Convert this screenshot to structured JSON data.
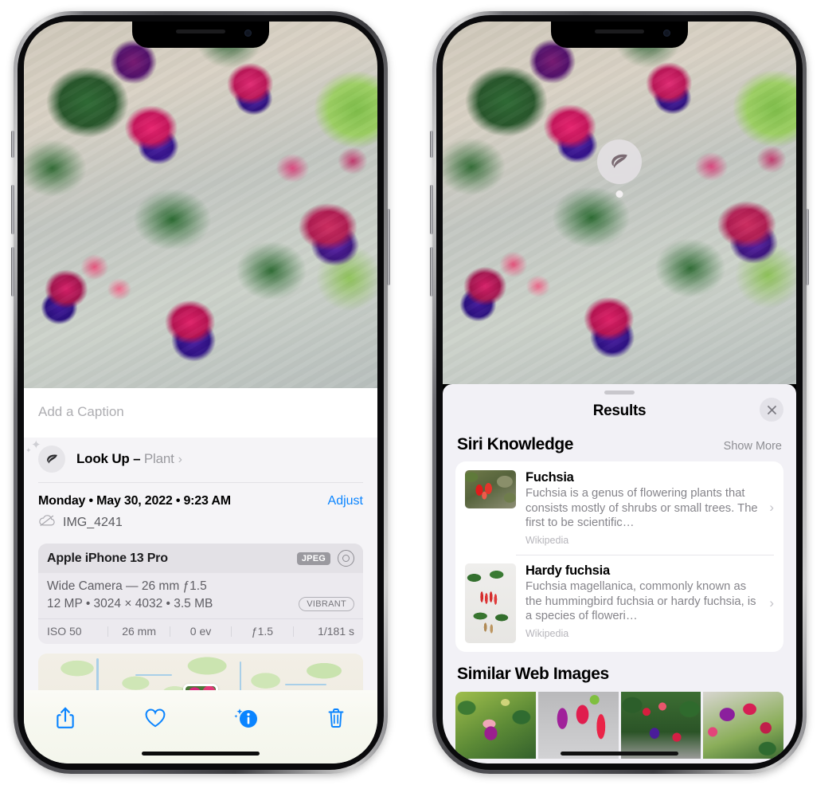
{
  "left_phone": {
    "caption_placeholder": "Add a Caption",
    "lookup": {
      "label": "Look Up – ",
      "subject": "Plant",
      "icon": "leaf-icon",
      "chevron": "›"
    },
    "meta": {
      "date": "Monday • May 30, 2022 • 9:23 AM",
      "adjust_label": "Adjust",
      "filename": "IMG_4241",
      "cloud_icon": "icloud-slash-icon"
    },
    "camera_card": {
      "device": "Apple iPhone 13 Pro",
      "format_badge": "JPEG",
      "raw_icon": "raw-aperture-icon",
      "lens_line": "Wide Camera — 26 mm ƒ1.5",
      "size_line": "12 MP • 3024 × 4032 • 3.5 MB",
      "style_badge": "VIBRANT",
      "exif": [
        "ISO 50",
        "26 mm",
        "0 ev",
        "ƒ1.5",
        "1/181 s"
      ]
    },
    "toolbar": [
      {
        "name": "share-button",
        "icon": "share-icon"
      },
      {
        "name": "favorite-button",
        "icon": "heart-icon"
      },
      {
        "name": "info-button",
        "icon": "info-sparkle-icon"
      },
      {
        "name": "delete-button",
        "icon": "trash-icon"
      }
    ],
    "accent_color": "#0a84ff"
  },
  "right_phone": {
    "pin": {
      "icon": "leaf-icon"
    },
    "sheet": {
      "title": "Results",
      "close_label": "✕"
    },
    "siri_knowledge": {
      "heading": "Siri Knowledge",
      "show_more": "Show More",
      "items": [
        {
          "title": "Fuchsia",
          "description": "Fuchsia is a genus of flowering plants that consists mostly of shrubs or small trees. The first to be scientific…",
          "source": "Wikipedia",
          "chevron": "›"
        },
        {
          "title": "Hardy fuchsia",
          "description": "Fuchsia magellanica, commonly known as the hummingbird fuchsia or hardy fuchsia, is a species of floweri…",
          "source": "Wikipedia",
          "chevron": "›"
        }
      ]
    },
    "similar_web_images": {
      "heading": "Similar Web Images",
      "thumbnails": [
        "fuchsia-image-1",
        "fuchsia-image-2",
        "fuchsia-image-3",
        "fuchsia-image-4"
      ]
    }
  }
}
